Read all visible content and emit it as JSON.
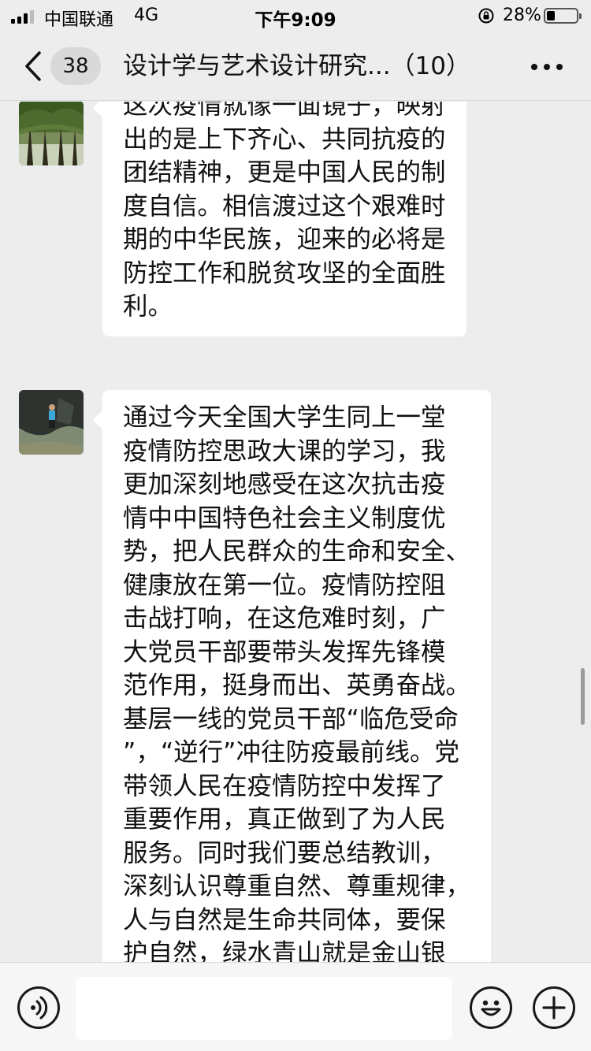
{
  "status_bar": {
    "carrier": "中国联通",
    "network": "4G",
    "time": "下午9:09",
    "battery_percent": "28%",
    "battery_level": 0.28,
    "icons": [
      "signal-icon",
      "orientation-lock-icon",
      "battery-icon"
    ]
  },
  "nav": {
    "unread_count": "38",
    "title": "设计学与艺术设计研究...（10）",
    "icons": [
      "back-chevron-icon",
      "more-dots-icon"
    ]
  },
  "messages": [
    {
      "avatar": "avatar-trees",
      "lines": [
        "这次疫情就像一面镜子，映射",
        "出的是上下齐心、共同抗疫的",
        "团结精神，更是中国人民的制",
        "度自信。相信渡过这个艰难时",
        "期的中华民族，迎来的必将是",
        "防控工作和脱贫攻坚的全面胜",
        "利。"
      ]
    },
    {
      "avatar": "avatar-rock",
      "lines": [
        "通过今天全国大学生同上一堂",
        "疫情防控思政大课的学习，我",
        "更加深刻地感受在这次抗击疫",
        "情中中国特色社会主义制度优",
        "势，把人民群众的生命和安全、",
        "健康放在第一位。疫情防控阻",
        "击战打响，在这危难时刻，广",
        "大党员干部要带头发挥先锋模",
        "范作用，挺身而出、英勇奋战。",
        "基层一线的党员干部“临危受命",
        "”，“逆行”冲往防疫最前线。党",
        "带领人民在疫情防控中发挥了",
        "重要作用，真正做到了为人民",
        "服务。同时我们要总结教训，",
        "深刻认识尊重自然、尊重规律，",
        "人与自然是生命共同体，要保",
        "护自然，绿水青山就是金山银"
      ]
    }
  ],
  "input_bar": {
    "placeholder": "",
    "icons": [
      "voice-icon",
      "emoji-icon",
      "plus-icon"
    ]
  }
}
